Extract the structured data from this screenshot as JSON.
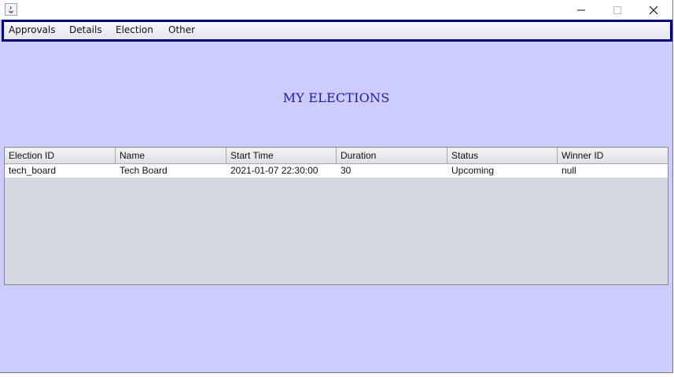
{
  "menubar": {
    "items": [
      "Approvals",
      "Details",
      "Election",
      "Other"
    ]
  },
  "main": {
    "title": "MY ELECTIONS"
  },
  "table": {
    "columns": [
      "Election ID",
      "Name",
      "Start Time",
      "Duration",
      "Status",
      "Winner ID"
    ],
    "rows": [
      [
        "tech_board",
        "Tech Board",
        "2021-01-07 22:30:00",
        "30",
        "Upcoming",
        "null"
      ]
    ]
  },
  "colors": {
    "window_bg": "#ccccff",
    "menubar_border": "#00007d",
    "title": "#1a1ab3",
    "table_empty_bg": "#d5d8df"
  },
  "icons": [
    "java-app-icon",
    "minimize-icon",
    "maximize-icon",
    "close-icon"
  ]
}
